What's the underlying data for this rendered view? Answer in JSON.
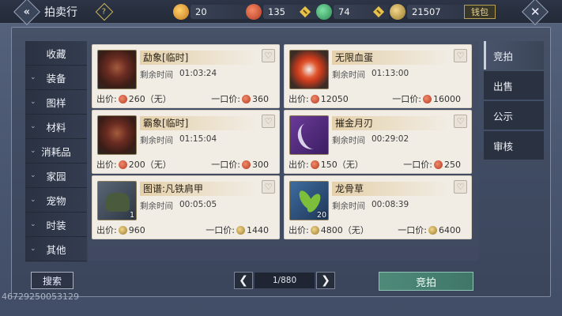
{
  "topbar": {
    "title": "拍卖行",
    "help_icon": "question-icon",
    "resources": [
      {
        "name": "gold-ingot",
        "value": "20",
        "color": "#e6a43a"
      },
      {
        "name": "red-coin",
        "value": "135",
        "color": "#d9583a"
      },
      {
        "name": "jade-coin",
        "value": "74",
        "color": "#3aa86a"
      },
      {
        "name": "gold-leaf",
        "value": "21507",
        "color": "#d2a34c"
      }
    ],
    "wallet_label": "钱包"
  },
  "sidebar_left": {
    "items": [
      {
        "label": "收藏",
        "chev": false
      },
      {
        "label": "装备",
        "chev": true
      },
      {
        "label": "图样",
        "chev": true
      },
      {
        "label": "材料",
        "chev": true
      },
      {
        "label": "消耗品",
        "chev": true
      },
      {
        "label": "家园",
        "chev": true
      },
      {
        "label": "宠物",
        "chev": true
      },
      {
        "label": "时装",
        "chev": true
      },
      {
        "label": "其他",
        "chev": true
      }
    ]
  },
  "listings": [
    {
      "name": "勐象[临时]",
      "time_label": "剩余时间",
      "time": "01:03:24",
      "bid_label": "出价:",
      "bid": "260（无）",
      "buyout_label": "一口价:",
      "buyout": "360",
      "currency": "red",
      "qty": ""
    },
    {
      "name": "无限血蛋",
      "time_label": "剩余时间",
      "time": "01:13:00",
      "bid_label": "出价:",
      "bid": "12050",
      "buyout_label": "一口价:",
      "buyout": "16000",
      "currency": "red",
      "qty": ""
    },
    {
      "name": "霸象[临时]",
      "time_label": "剩余时间",
      "time": "01:15:04",
      "bid_label": "出价:",
      "bid": "200（无）",
      "buyout_label": "一口价:",
      "buyout": "300",
      "currency": "red",
      "qty": ""
    },
    {
      "name": "摧金月刃",
      "time_label": "剩余时间",
      "time": "00:29:02",
      "bid_label": "出价:",
      "bid": "150（无）",
      "buyout_label": "一口价:",
      "buyout": "250",
      "currency": "red",
      "qty": ""
    },
    {
      "name": "图谱:凡铁肩甲",
      "time_label": "剩余时间",
      "time": "00:05:05",
      "bid_label": "出价:",
      "bid": "960",
      "buyout_label": "一口价:",
      "buyout": "1440",
      "currency": "gold",
      "qty": "1"
    },
    {
      "name": "龙骨草",
      "time_label": "剩余时间",
      "time": "00:08:39",
      "bid_label": "出价:",
      "bid": "4800（无）",
      "buyout_label": "一口价:",
      "buyout": "6400",
      "currency": "gold",
      "qty": "20"
    }
  ],
  "sidebar_right": {
    "tabs": [
      "竞拍",
      "出售",
      "公示",
      "审核"
    ],
    "active": "竞拍"
  },
  "footer": {
    "search_label": "搜索",
    "page": "1/880",
    "auction_label": "竞拍",
    "uid": "46729250053129"
  }
}
